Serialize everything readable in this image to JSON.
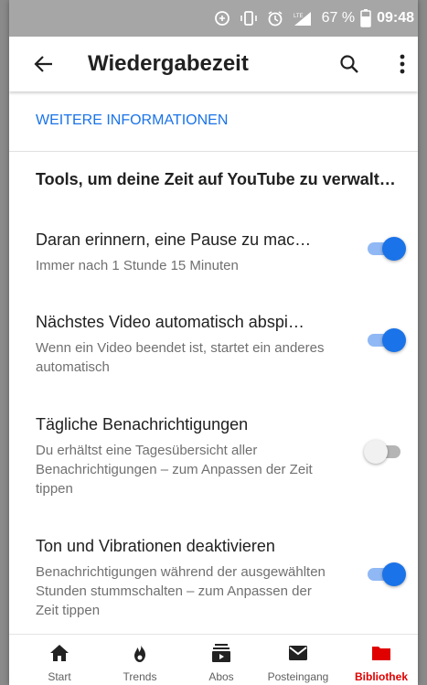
{
  "status_bar": {
    "battery_percent": "67 %",
    "time": "09:48",
    "network_label": "LTE",
    "icons": [
      "sync-icon",
      "vibrate-icon",
      "alarm-icon",
      "signal-icon",
      "battery-icon"
    ]
  },
  "app_bar": {
    "title": "Wiedergabezeit",
    "icons": [
      "back-arrow-icon",
      "search-icon",
      "more-vert-icon"
    ]
  },
  "link": {
    "label": "WEITERE INFORMATIONEN"
  },
  "section": {
    "title": "Tools, um deine Zeit auf YouTube zu verwalt…"
  },
  "settings": [
    {
      "title": "Daran erinnern, eine Pause zu mac…",
      "description": "Immer nach 1 Stunde 15 Minuten",
      "enabled": true
    },
    {
      "title": "Nächstes Video automatisch abspi…",
      "description": "Wenn ein Video beendet ist, startet ein anderes automatisch",
      "enabled": true
    },
    {
      "title": "Tägliche Benachrichtigungen",
      "description": "Du erhältst eine Tagesübersicht aller Benachrichtigungen – zum Anpassen der Zeit tippen",
      "enabled": false
    },
    {
      "title": "Ton und Vibrationen deaktivieren",
      "description": "Benachrichtigungen während der ausgewählten Stunden stummschalten – zum Anpassen der Zeit tippen",
      "enabled": true
    }
  ],
  "bottom_nav": {
    "items": [
      {
        "label": "Start",
        "icon": "home-icon",
        "active": false
      },
      {
        "label": "Trends",
        "icon": "flame-icon",
        "active": false
      },
      {
        "label": "Abos",
        "icon": "subscriptions-icon",
        "active": false
      },
      {
        "label": "Posteingang",
        "icon": "mail-icon",
        "active": false
      },
      {
        "label": "Bibliothek",
        "icon": "folder-icon",
        "active": true
      }
    ]
  },
  "colors": {
    "accent": "#1a73e8",
    "accent_track": "#90b8f5",
    "active_nav": "#e00000",
    "status_bar": "#a6a6a6",
    "text_primary": "#212121",
    "text_secondary": "#707070"
  }
}
